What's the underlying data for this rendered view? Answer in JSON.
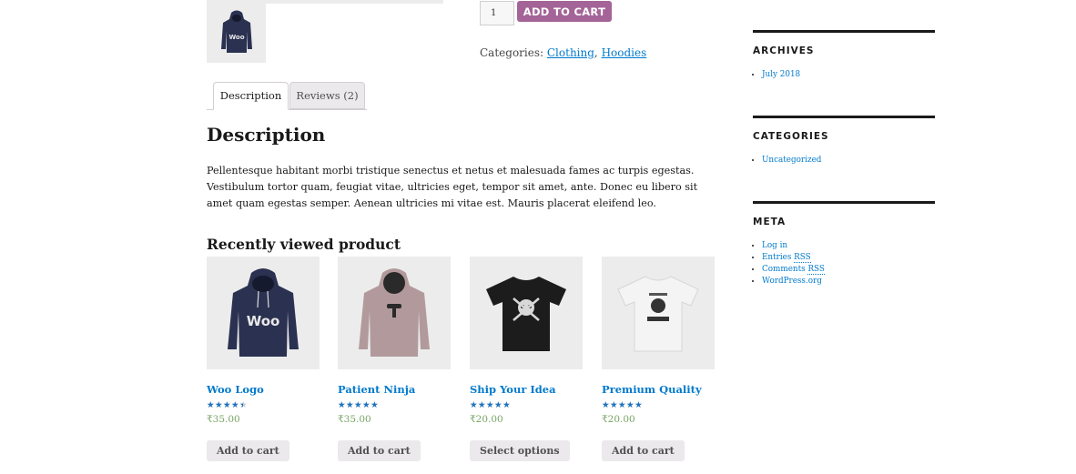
{
  "product": {
    "quantity": "1",
    "add_to_cart_label": "ADD TO CART",
    "categories_label": "Categories:",
    "categories": [
      "Clothing",
      "Hoodies"
    ],
    "categories_separator": ","
  },
  "tabs": [
    {
      "label": "Description",
      "active": true
    },
    {
      "label": "Reviews (2)",
      "active": false
    }
  ],
  "description": {
    "heading": "Description",
    "text": "Pellentesque habitant morbi tristique senectus et netus et malesuada fames ac turpis egestas. Vestibulum tortor quam, feugiat vitae, ultricies eget, tempor sit amet, ante. Donec eu libero sit amet quam egestas semper. Aenean ultricies mi vitae est. Mauris placerat eleifend leo."
  },
  "recently_viewed": {
    "heading": "Recently viewed product",
    "products": [
      {
        "name": "Woo Logo",
        "rating": 4,
        "price": "₹35.00",
        "button": "Add to cart",
        "image": "navy-hoodie"
      },
      {
        "name": "Patient Ninja",
        "rating": 4.67,
        "price": "₹35.00",
        "button": "Add to cart",
        "image": "mauve-hoodie"
      },
      {
        "name": "Ship Your Idea",
        "rating": 4.5,
        "price": "₹20.00",
        "button": "Select options",
        "image": "black-tshirt"
      },
      {
        "name": "Premium Quality",
        "rating": 4.5,
        "price": "₹20.00",
        "button": "Add to cart",
        "image": "white-tshirt"
      }
    ]
  },
  "sidebar": {
    "archives": {
      "title": "ARCHIVES",
      "items": [
        "July 2018"
      ]
    },
    "categories": {
      "title": "CATEGORIES",
      "items": [
        "Uncategorized"
      ]
    },
    "meta": {
      "title": "META",
      "log_in": "Log in",
      "entries_prefix": "Entries ",
      "entries_rss": "RSS",
      "comments_prefix": "Comments ",
      "comments_rss": "RSS",
      "wordpress": "WordPress.org"
    }
  },
  "colors": {
    "accent_button": "#a46497",
    "link": "#007acc",
    "price": "#77a464",
    "stars": "#1e73be"
  }
}
